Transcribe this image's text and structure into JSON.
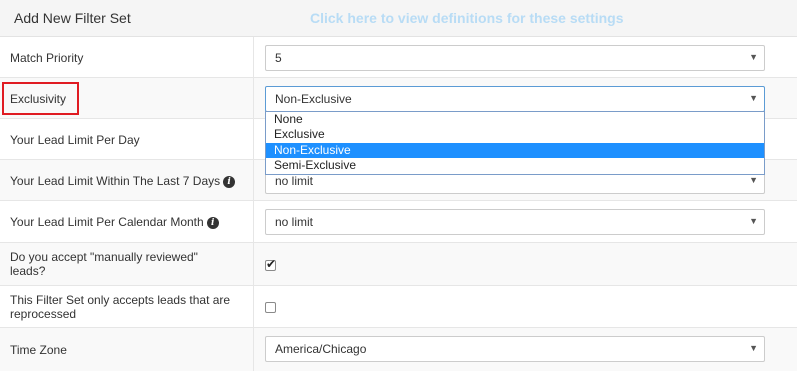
{
  "header": {
    "title": "Add New Filter Set",
    "definitions_link": "Click here to view definitions for these settings"
  },
  "rows": {
    "match_priority": {
      "label": "Match Priority",
      "value": "5"
    },
    "exclusivity": {
      "label": "Exclusivity",
      "value": "Non-Exclusive"
    },
    "lead_limit_day": {
      "label": "Your Lead Limit Per Day"
    },
    "lead_limit_7days": {
      "label": "Your Lead Limit Within The Last 7 Days",
      "value": "no limit"
    },
    "lead_limit_month": {
      "label": "Your Lead Limit Per Calendar Month",
      "value": "no limit"
    },
    "manually_reviewed": {
      "label_line1": "Do you accept \"manually reviewed\"",
      "label_line2": "leads?",
      "checked": true
    },
    "reprocessed": {
      "label_line1": "This Filter Set only accepts leads that are",
      "label_line2": "reprocessed",
      "checked": false
    },
    "time_zone": {
      "label": "Time Zone",
      "value": "America/Chicago"
    }
  },
  "exclusivity_options": [
    "None",
    "Exclusive",
    "Non-Exclusive",
    "Semi-Exclusive"
  ],
  "exclusivity_selected_index": 2,
  "colors": {
    "highlight_box": "#e01b22",
    "selected_option": "#1e90ff",
    "link": "#b8dcf5"
  },
  "icons": {
    "info": "info-circle-icon",
    "dropdown": "chevron-down-icon",
    "checkbox": "check-icon"
  }
}
